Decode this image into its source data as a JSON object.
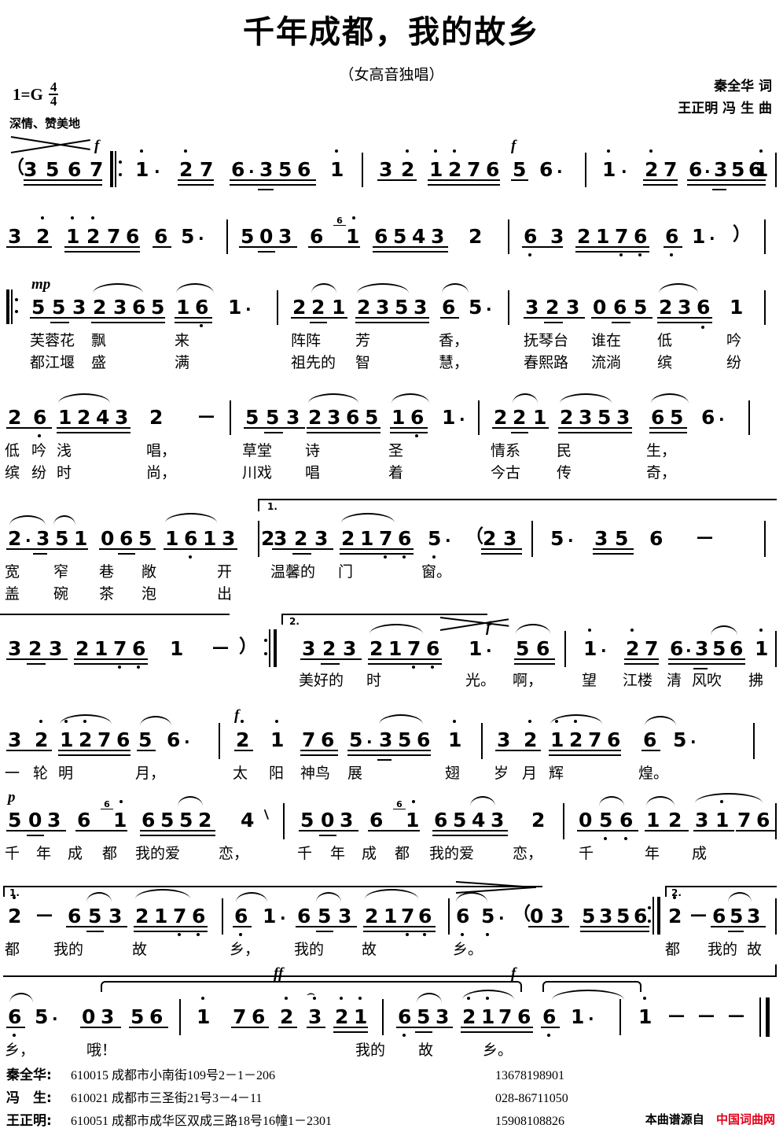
{
  "header": {
    "title": "千年成都，我的故乡",
    "subtitle": "（女高音独唱）",
    "key": "1=G",
    "meter_num": "4",
    "meter_den": "4",
    "expression": "深情、赞美地",
    "lyricist": "秦全华 词",
    "composer": "王正明 冯 生 曲"
  },
  "dynamics": {
    "f": "f",
    "mp": "mp",
    "p": "p",
    "ff": "ff"
  },
  "marks": {
    "sextuplet": "6",
    "volta1": "1.",
    "volta2": "2.",
    "paren_open": "（",
    "paren_close": "）",
    "dash": "－",
    "dot": "·"
  },
  "systems": [
    {
      "id": "system-1",
      "notes": "（3 5 6 7 ‖: i· 2̇ 7 6·3 5 6 i | 3 2̇ i 2̇ 7 6 5 6· | i· 2̇ 7 6·3 5 6 i |",
      "measures": [
        {
          "pickup": "3 5 6 7"
        },
        {
          "cells": "i . 2 7 6 . 3 5 6 i"
        },
        {
          "cells": "3 2 1 2 7 6 5 6 ."
        },
        {
          "cells": "i . 2 7 6 . 3 5 6 i"
        }
      ]
    },
    {
      "id": "system-2",
      "measures": [
        {
          "cells": "3 2 1 2 7 6 6 5 ."
        },
        {
          "cells": "5 0 3 6 1 6 5 4 3 2"
        },
        {
          "cells": "6 3 2 1 7 6 6 1 . ）"
        }
      ]
    },
    {
      "id": "system-3",
      "measures": [
        {
          "cells": "5 5 3 2 3 6 5 1 6 1 ."
        },
        {
          "cells": "2 2 1 2 3 5 3 6 5 ."
        },
        {
          "cells": "3 2 3 0 6 5 2 3 6 1"
        }
      ],
      "lyrics1": [
        "芙蓉花",
        "飘",
        "来",
        "阵阵",
        "芳",
        "香，",
        "抚琴台",
        "谁在",
        "低",
        "吟"
      ],
      "lyrics2": [
        "都江堰",
        "盛",
        "满",
        "祖先的",
        "智",
        "慧，",
        "春熙路",
        "流淌",
        "缤",
        "纷"
      ]
    },
    {
      "id": "system-4",
      "measures": [
        {
          "cells": "2 6 1 2 4 3 2 －"
        },
        {
          "cells": "5 5 3 2 3 6 5 1 6 1 ."
        },
        {
          "cells": "2 2 1 2 3 5 3 6 5 6 ."
        }
      ],
      "lyrics1": [
        "低",
        "吟",
        "浅",
        "唱，",
        "草堂",
        "诗",
        "圣",
        "情系",
        "民",
        "生，"
      ],
      "lyrics2": [
        "缤",
        "纷",
        "时",
        "尚，",
        "川戏",
        "唱",
        "着",
        "今古",
        "传",
        "奇，"
      ]
    },
    {
      "id": "system-5",
      "measures": [
        {
          "cells": "2·3 5 1 0 6 5 1 6 1 3 2"
        },
        {
          "volta": "1.",
          "cells": "3 2 3 2 1 7 6 5 . （2 3"
        },
        {
          "cells": "5 . 3 5 6 －"
        }
      ],
      "lyrics1": [
        "宽",
        "窄",
        "巷",
        "敞",
        "开",
        "温馨的",
        "门",
        "窗。"
      ],
      "lyrics2": [
        "盖",
        "碗",
        "茶",
        "泡",
        "出"
      ]
    },
    {
      "id": "system-6",
      "measures": [
        {
          "cells": "3 2 3 2 1 7 6 1 － ）"
        },
        {
          "volta": "2.",
          "cells": "3 2 3 2 1 7 6 1 . 5 6"
        },
        {
          "cells": "i· 2 7 6·3 5 6 i"
        }
      ],
      "lyrics": [
        "美好的",
        "时",
        "光。",
        "啊，",
        "望",
        "江楼",
        "清",
        "风吹",
        "拂"
      ]
    },
    {
      "id": "system-7",
      "measures": [
        {
          "cells": "3 2 1 2 7 6 5 6 ."
        },
        {
          "cells": "2 i 7 6 5·3 5 6 i"
        },
        {
          "cells": "3 2 1 2 7 6 6 5 ."
        }
      ],
      "lyrics": [
        "一",
        "轮",
        "明",
        "月，",
        "太",
        "阳",
        "神鸟",
        "展",
        "翅",
        "岁",
        "月",
        "辉",
        "煌。"
      ]
    },
    {
      "id": "system-8",
      "measures": [
        {
          "cells": "5 0 3 6 1 6 5 5 2 4"
        },
        {
          "cells": "5 0 3 6 1 6 5 4 3 2"
        },
        {
          "cells": "0 5 6 1 2 3 i 7 6"
        }
      ],
      "lyrics": [
        "千",
        "年",
        "成",
        "都",
        "我的爱",
        "恋，",
        "千",
        "年",
        "成",
        "都",
        "我的爱",
        "恋，",
        "千",
        "年",
        "成"
      ]
    },
    {
      "id": "system-9",
      "measures": [
        {
          "volta": "1.",
          "cells": "2 － 6 5 3 2 1 7 6"
        },
        {
          "cells": "6 1 . 6 5 3 2 1 7 6"
        },
        {
          "cells": "6 5 . （0 3 5 3 5 6"
        },
        {
          "volta": "2.",
          "cells": "2 － 6 5 3 2 1 7 6"
        }
      ],
      "lyrics1": [
        "都",
        "我的",
        "故",
        "乡，",
        "我的",
        "故",
        "乡。"
      ],
      "lyrics2": [
        "都",
        "我的",
        "故"
      ]
    },
    {
      "id": "system-10",
      "measures": [
        {
          "cells": "6 5 . 0 3 5 6"
        },
        {
          "cells": "i 7 6 2 3 2 i"
        },
        {
          "cells": "6 5 3 2 i 7 6 6 1 ."
        },
        {
          "cells": "i － － －"
        }
      ],
      "lyrics": [
        "乡，",
        "哦！",
        "我的",
        "故",
        "乡。"
      ]
    }
  ],
  "footer": {
    "contacts": [
      {
        "name": "秦全华:",
        "address": "610015  成都市小南街109号2－1－206",
        "phone": "13678198901"
      },
      {
        "name": "冯　生:",
        "address": "610021  成都市三圣街21号3－4－11",
        "phone": "028-86711050"
      },
      {
        "name": "王正明:",
        "address": "610051  成都市成华区双成三路18号16幢1－2301",
        "phone": "15908108826"
      }
    ],
    "source_label": "本曲谱源自",
    "source_site": "中国词曲网"
  }
}
